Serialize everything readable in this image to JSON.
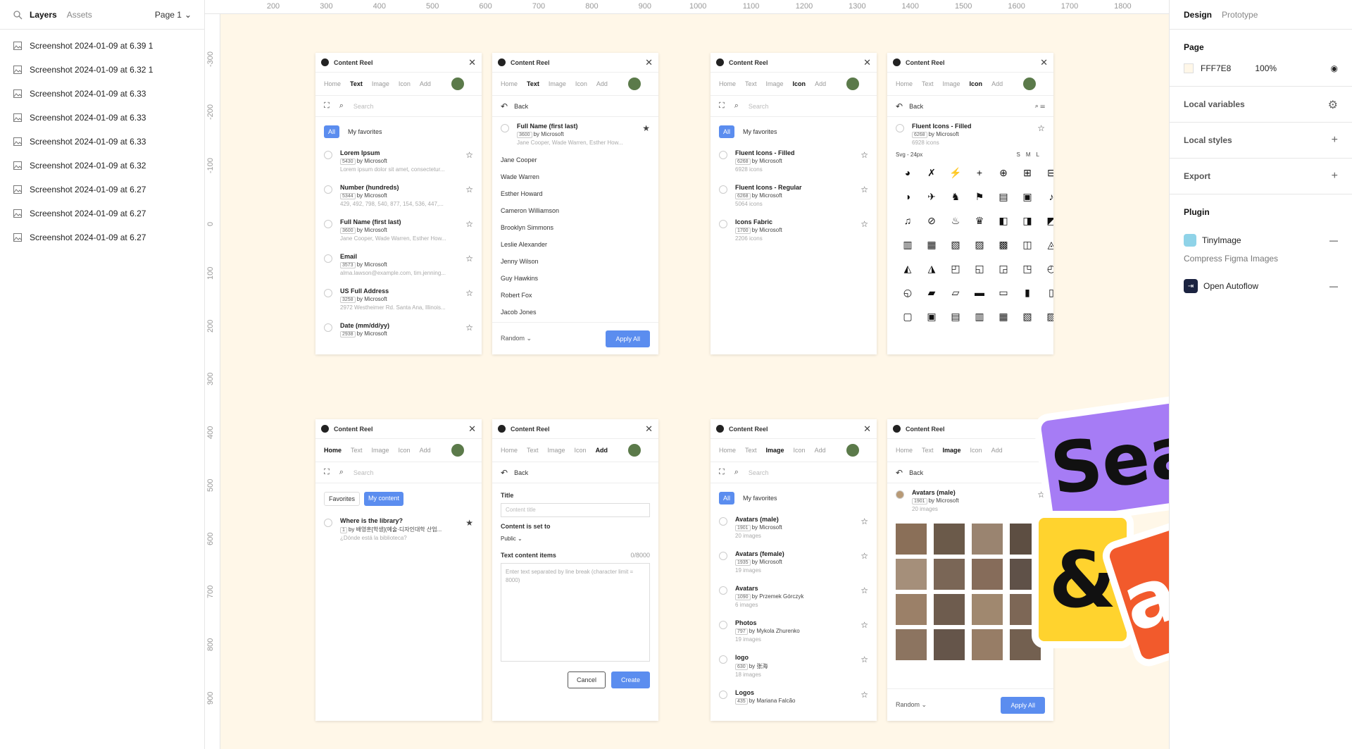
{
  "left": {
    "tabs": [
      "Layers",
      "Assets"
    ],
    "page": "Page 1",
    "layers": [
      "Screenshot 2024-01-09 at 6.39 1",
      "Screenshot 2024-01-09 at 6.32 1",
      "Screenshot 2024-01-09 at 6.33",
      "Screenshot 2024-01-09 at 6.33",
      "Screenshot 2024-01-09 at 6.33",
      "Screenshot 2024-01-09 at 6.32",
      "Screenshot 2024-01-09 at 6.27",
      "Screenshot 2024-01-09 at 6.27",
      "Screenshot 2024-01-09 at 6.27"
    ]
  },
  "ruler": {
    "top": [
      "200",
      "300",
      "400",
      "500",
      "600",
      "700",
      "800",
      "900",
      "1000",
      "1100",
      "1200",
      "1300",
      "1400",
      "1500",
      "1600",
      "1700",
      "1800"
    ],
    "left": [
      "-300",
      "-200",
      "-100",
      "0",
      "100",
      "200",
      "300",
      "400",
      "500",
      "600",
      "700",
      "800",
      "900"
    ]
  },
  "right": {
    "tabs": [
      "Design",
      "Prototype"
    ],
    "page": "Page",
    "page_color": "FFF7E8",
    "page_opacity": "100%",
    "local_variables": "Local variables",
    "local_styles": "Local styles",
    "export": "Export",
    "plugin": "Plugin",
    "plugins": [
      {
        "name": "TinyImage",
        "desc": "Compress Figma Images"
      },
      {
        "name": "Open Autoflow",
        "desc": ""
      }
    ]
  },
  "plugin_ui": {
    "title": "Content Reel",
    "nav": [
      "Home",
      "Text",
      "Image",
      "Icon",
      "Add"
    ],
    "search": "Search",
    "back": "Back",
    "all": "All",
    "favorites": "My favorites",
    "fav2": "Favorites",
    "mycontent": "My content",
    "random": "Random",
    "apply": "Apply All",
    "cancel": "Cancel",
    "create": "Create"
  },
  "text_items": [
    {
      "t": "Lorem Ipsum",
      "n": "5430",
      "d": "Lorem ipsum dolor sit amet, consectetur..."
    },
    {
      "t": "Number (hundreds)",
      "n": "5344",
      "d": "429, 492, 798, 540, 877, 154, 536, 447,..."
    },
    {
      "t": "Full Name (first last)",
      "n": "3600",
      "d": "Jane Cooper, Wade Warren, Esther How..."
    },
    {
      "t": "Email",
      "n": "3573",
      "d": "alma.lawson@example.com, tim.jenning..."
    },
    {
      "t": "US Full Address",
      "n": "3258",
      "d": "2972 Westheimer Rd. Santa Ana, Illinois..."
    },
    {
      "t": "Date (mm/dd/yy)",
      "n": "2938",
      "d": ""
    }
  ],
  "by": "by Microsoft",
  "names": [
    "Jane Cooper",
    "Wade Warren",
    "Esther Howard",
    "Cameron Williamson",
    "Brooklyn Simmons",
    "Leslie Alexander",
    "Jenny Wilson",
    "Guy Hawkins",
    "Robert Fox",
    "Jacob Jones"
  ],
  "icon_items": [
    {
      "t": "Fluent Icons - Filled",
      "n": "6268",
      "d": "6928 icons"
    },
    {
      "t": "Fluent Icons - Regular",
      "n": "6268",
      "d": "5064 icons"
    },
    {
      "t": "Icons Fabric",
      "n": "1700",
      "d": "2206 icons"
    }
  ],
  "icon_detail": {
    "t": "Fluent Icons - Filled",
    "n": "6268",
    "d": "6928 icons",
    "size": "Svg - 24px",
    "sizes": [
      "S",
      "M",
      "L"
    ]
  },
  "home_item": {
    "t": "Where is the library?",
    "n": "1",
    "by": "by 배영훈[학생](예술·디자인대학 산업...",
    "d": "¿Dónde está la biblioteca?"
  },
  "add_form": {
    "title": "Title",
    "title_ph": "Content title",
    "set": "Content is set to",
    "public": "Public",
    "items": "Text content items",
    "count": "0/8000",
    "ph": "Enter text separated by line break (character limit = 8000)"
  },
  "image_items": [
    {
      "t": "Avatars (male)",
      "n": "1901",
      "by": "by Microsoft",
      "d": "20 images"
    },
    {
      "t": "Avatars (female)",
      "n": "1935",
      "by": "by Microsoft",
      "d": "19 images"
    },
    {
      "t": "Avatars",
      "n": "1090",
      "by": "by Przemek Górczyk",
      "d": "6 images"
    },
    {
      "t": "Photos",
      "n": "797",
      "by": "by Mykola Zhurenko",
      "d": "19 images"
    },
    {
      "t": "logo",
      "n": "630",
      "by": "by 张海",
      "d": "18 images"
    },
    {
      "t": "Logos",
      "n": "435",
      "by": "by Mariana Falcão",
      "d": ""
    }
  ],
  "image_detail": {
    "t": "Avatars (male)",
    "n": "1901",
    "d": "20 images"
  },
  "promo": {
    "w1": "Search",
    "w2": "&",
    "w3": "apply",
    "c1": "#A67CF5",
    "c2": "#FFD32E",
    "c3": "#F25A2C"
  }
}
